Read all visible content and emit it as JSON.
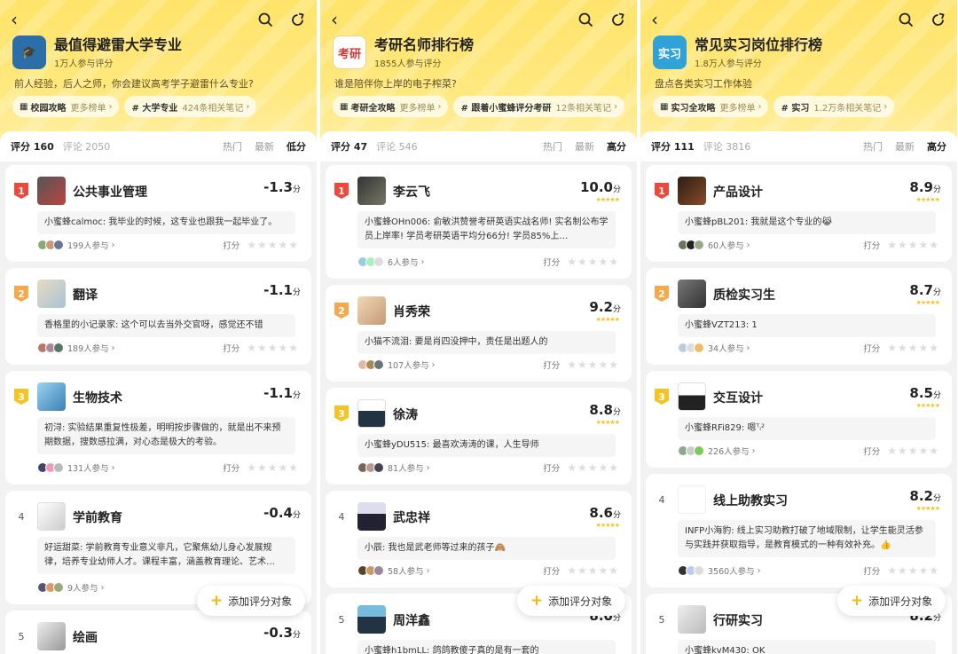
{
  "panels": [
    {
      "title": "最值得避雷大学专业",
      "participants": "1万人参与评分",
      "description": "前人经验，后人之师，你会建议高考学子避雷什么专业?",
      "chips": [
        {
          "label": "校园攻略",
          "sub": "更多榜单",
          "icon": "grid-icon"
        },
        {
          "label": "# 大学专业",
          "sub": "424条相关笔记",
          "icon": "hash-icon"
        }
      ],
      "tab_score": "评分 160",
      "tab_comment": "评论 2050",
      "sort_options": [
        "热门",
        "最新",
        "低分"
      ],
      "sort_selected": "低分",
      "fab_label": "添加评分对象",
      "items": [
        {
          "rank": "1",
          "name": "公共事业管理",
          "score": "-1.3",
          "unit": "分",
          "comment": "小蜜蜂calmoc: 我毕业的时候，这专业也跟我一起毕业了。",
          "count": "199人参与",
          "rate_label": "打分"
        },
        {
          "rank": "2",
          "name": "翻译",
          "score": "-1.1",
          "unit": "分",
          "comment": "香格里的小记录家: 这个可以去当外交官呀，感觉还不错",
          "count": "189人参与",
          "rate_label": "打分"
        },
        {
          "rank": "3",
          "name": "生物技术",
          "score": "-1.1",
          "unit": "分",
          "comment": "初浔: 实验结果重复性极差，明明按步骤做的，就是出不来预期数据，搜数感拉满，对心态是极大的考验。",
          "count": "131人参与",
          "rate_label": "打分"
        },
        {
          "rank": "4",
          "name": "学前教育",
          "score": "-0.4",
          "unit": "分",
          "comment": "好运甜菜: 学前教育专业意义非凡，它聚焦幼儿身心发展规律，培养专业幼师人才。课程丰富，涵盖教育理论、艺术…",
          "count": "9人参与",
          "rate_label": "打分"
        },
        {
          "rank": "5",
          "name": "绘画",
          "score": "-0.3",
          "unit": "分",
          "comment": "",
          "count": "",
          "rate_label": "打分"
        }
      ]
    },
    {
      "title": "考研名师排行榜",
      "participants": "1855人参与评分",
      "description": "谁是陪伴你上岸的电子榨菜?",
      "chips": [
        {
          "label": "考研全攻略",
          "sub": "更多榜单",
          "icon": "grid-icon"
        },
        {
          "label": "# 跟着小蜜蜂评分考研",
          "sub": "12条相关笔记",
          "icon": "hash-icon"
        }
      ],
      "tab_score": "评分 47",
      "tab_comment": "评论 546",
      "sort_options": [
        "热门",
        "最新",
        "高分"
      ],
      "sort_selected": "高分",
      "fab_label": "添加评分对象",
      "items": [
        {
          "rank": "1",
          "name": "李云飞",
          "score": "10.0",
          "unit": "分",
          "comment": "小蜜蜂OHn006: 俞敏洪赞誉考研英语实战名师! 实名制公布学员上岸率! 学员考研英语平均分66分! 学员85%上…",
          "count": "6人参与",
          "rate_label": "打分"
        },
        {
          "rank": "2",
          "name": "肖秀荣",
          "score": "9.2",
          "unit": "分",
          "comment": "小猫不流泪: 要是肖四没押中，责任是出题人的",
          "count": "107人参与",
          "rate_label": "打分"
        },
        {
          "rank": "3",
          "name": "徐涛",
          "score": "8.8",
          "unit": "分",
          "comment": "小蜜蜂yDU515: 最喜欢涛涛的课，人生导师",
          "count": "81人参与",
          "rate_label": "打分"
        },
        {
          "rank": "4",
          "name": "武忠祥",
          "score": "8.6",
          "unit": "分",
          "comment": "小辰: 我也是武老师等过来的孩子🙈",
          "count": "58人参与",
          "rate_label": "打分"
        },
        {
          "rank": "5",
          "name": "周洋鑫",
          "score": "8.0",
          "unit": "分",
          "comment": "小蜜蜂h1bmLL: 鸽鸽教傻子真的是有一套的",
          "count": "",
          "rate_label": "打分"
        }
      ]
    },
    {
      "title": "常见实习岗位排行榜",
      "participants": "1.8万人参与评分",
      "description": "盘点各类实习工作体验",
      "chips": [
        {
          "label": "实习全攻略",
          "sub": "更多榜单",
          "icon": "grid-icon"
        },
        {
          "label": "# 实习",
          "sub": "1.2万条相关笔记",
          "icon": "hash-icon"
        }
      ],
      "tab_score": "评分 111",
      "tab_comment": "评论 3816",
      "sort_options": [
        "热门",
        "最新",
        "高分"
      ],
      "sort_selected": "高分",
      "fab_label": "添加评分对象",
      "items": [
        {
          "rank": "1",
          "name": "产品设计",
          "score": "8.9",
          "unit": "分",
          "comment": "小蜜蜂pBL201: 我就是这个专业的😹",
          "count": "60人参与",
          "rate_label": "打分"
        },
        {
          "rank": "2",
          "name": "质检实习生",
          "score": "8.7",
          "unit": "分",
          "comment": "小蜜蜂VZT213: 1",
          "count": "34人参与",
          "rate_label": "打分"
        },
        {
          "rank": "3",
          "name": "交互设计",
          "score": "8.5",
          "unit": "分",
          "comment": "小蜜蜂RFi829: 嗯ᵀᵢ²",
          "count": "226人参与",
          "rate_label": "打分"
        },
        {
          "rank": "4",
          "name": "线上助教实习",
          "score": "8.2",
          "unit": "分",
          "comment": "INFP小海豹: 线上实习助教打破了地域限制，让学生能灵活参与实践并获取指导，是教育模式的一种有效补充。👍",
          "count": "3560人参与",
          "rate_label": "打分"
        },
        {
          "rank": "5",
          "name": "行研实习",
          "score": "8.2",
          "unit": "分",
          "comment": "小蜜蜂kvM430: OK",
          "count": "",
          "rate_label": "打分"
        }
      ]
    }
  ]
}
